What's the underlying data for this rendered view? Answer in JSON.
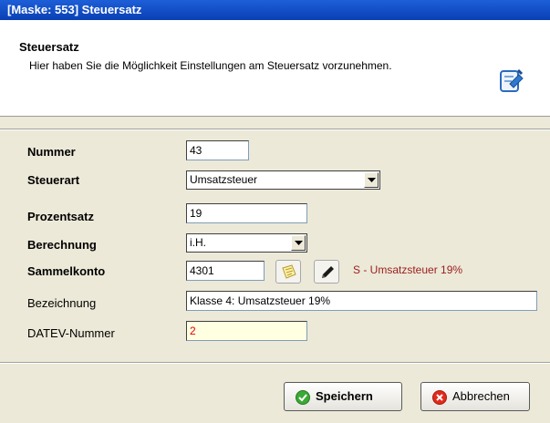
{
  "window": {
    "title": "[Maske: 553] Steuersatz"
  },
  "header": {
    "title": "Steuersatz",
    "description": "Hier haben Sie die Möglichkeit Einstellungen am Steuersatz vorzunehmen.",
    "icon": "document-edit-icon"
  },
  "form": {
    "nummer": {
      "label": "Nummer",
      "value": "43"
    },
    "steuerart": {
      "label": "Steuerart",
      "value": "Umsatzsteuer"
    },
    "prozentsatz": {
      "label": "Prozentsatz",
      "value": "19"
    },
    "berechnung": {
      "label": "Berechnung",
      "value": "i.H."
    },
    "sammelkonto": {
      "label": "Sammelkonto",
      "value": "4301",
      "hint": "S - Umsatzsteuer 19%"
    },
    "bezeichnung": {
      "label": "Bezeichnung",
      "value": "Klasse 4: Umsatzsteuer 19%"
    },
    "datev": {
      "label": "DATEV-Nummer",
      "value": "2"
    }
  },
  "buttons": {
    "save": "Speichern",
    "cancel": "Abbrechen"
  },
  "colors": {
    "title_bar": "#0a3fb5",
    "hint": "#9b1c1c",
    "datev_bg": "#ffffe1",
    "datev_text": "#e00000"
  }
}
